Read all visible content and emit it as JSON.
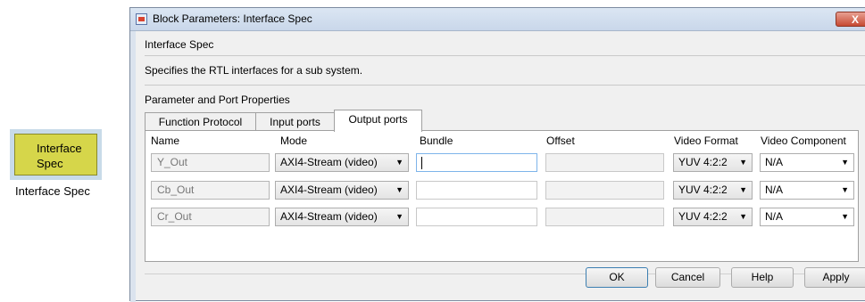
{
  "block": {
    "line1": "Interface",
    "line2": "Spec",
    "caption": "Interface Spec"
  },
  "window": {
    "title": "Block Parameters: Interface Spec",
    "close": "X"
  },
  "section_title": "Interface Spec",
  "description": "Specifies the RTL interfaces for a sub system.",
  "params_title": "Parameter and Port Properties",
  "tabs": [
    {
      "label": "Function Protocol"
    },
    {
      "label": "Input ports"
    },
    {
      "label": "Output ports"
    }
  ],
  "table": {
    "headers": [
      "Name",
      "Mode",
      "Bundle",
      "Offset",
      "Video Format",
      "Video Component"
    ],
    "rows": [
      {
        "name": "Y_Out",
        "mode": "AXI4-Stream (video)",
        "bundle": "",
        "offset": "",
        "format": "YUV 4:2:2",
        "component": "N/A"
      },
      {
        "name": "Cb_Out",
        "mode": "AXI4-Stream (video)",
        "bundle": "",
        "offset": "",
        "format": "YUV 4:2:2",
        "component": "N/A"
      },
      {
        "name": "Cr_Out",
        "mode": "AXI4-Stream (video)",
        "bundle": "",
        "offset": "",
        "format": "YUV 4:2:2",
        "component": "N/A"
      }
    ]
  },
  "buttons": {
    "ok": "OK",
    "cancel": "Cancel",
    "help": "Help",
    "apply": "Apply"
  }
}
